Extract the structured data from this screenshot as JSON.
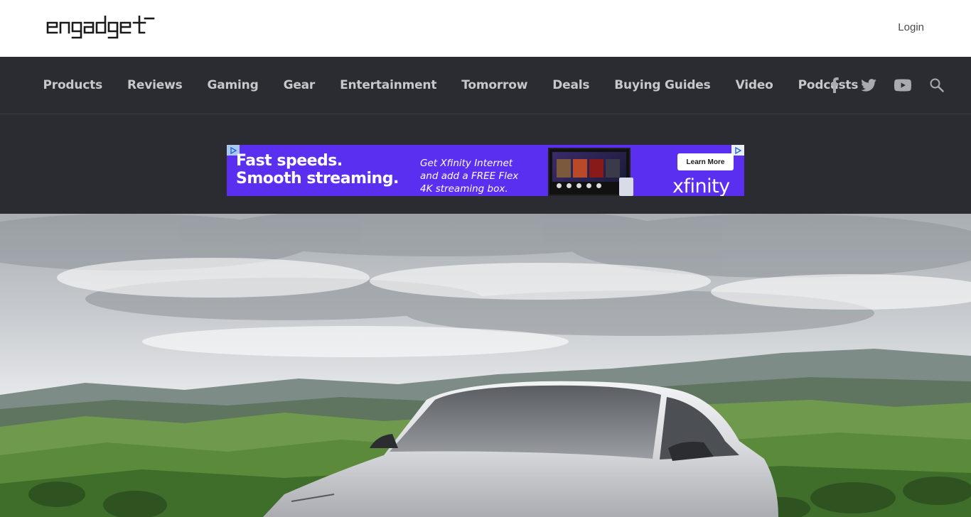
{
  "header": {
    "logo_text": "engadget",
    "login_label": "Login"
  },
  "nav": {
    "items": [
      {
        "label": "Products"
      },
      {
        "label": "Reviews"
      },
      {
        "label": "Gaming"
      },
      {
        "label": "Gear"
      },
      {
        "label": "Entertainment"
      },
      {
        "label": "Tomorrow"
      },
      {
        "label": "Deals"
      },
      {
        "label": "Buying Guides"
      },
      {
        "label": "Video"
      },
      {
        "label": "Podcasts"
      }
    ],
    "social_icons": [
      "facebook-icon",
      "twitter-icon",
      "youtube-icon",
      "search-icon"
    ]
  },
  "ad": {
    "headline_line1": "Fast speeds.",
    "headline_line2": "Smooth streaming.",
    "copy_line1": "Get Xfinity Internet",
    "copy_line2": "and add a FREE Flex",
    "copy_line3": "4K streaming box.",
    "button_label": "Learn More",
    "brand": "xfinity",
    "background_color": "#5a2ff0"
  },
  "colors": {
    "nav_background": "#2b2c31",
    "nav_text": "#c7c8cc",
    "page_background": "#ffffff"
  }
}
